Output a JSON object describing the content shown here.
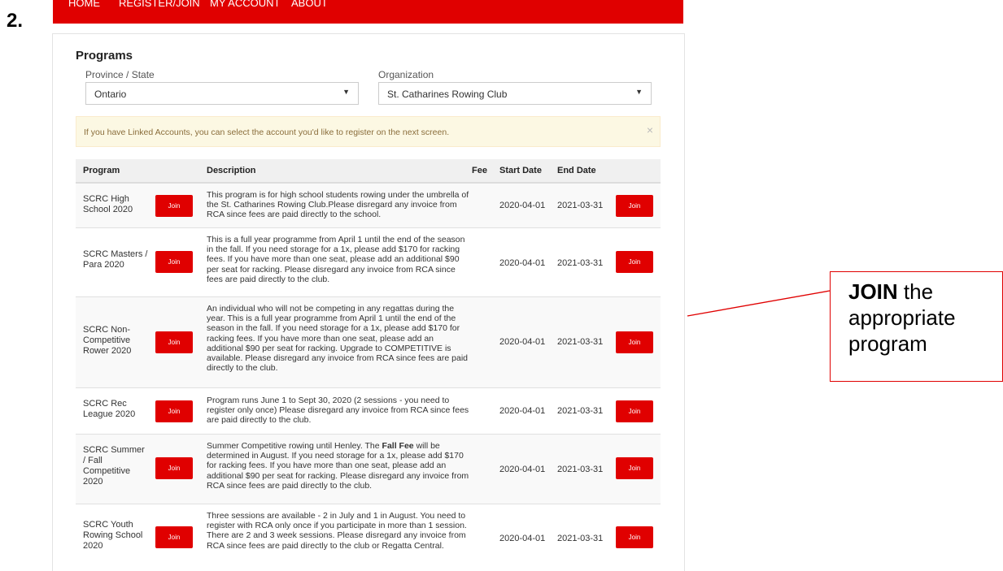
{
  "step_label": "2.",
  "nav": [
    "HOME",
    "REGISTER/JOIN",
    "MY ACCOUNT",
    "ABOUT"
  ],
  "programs": {
    "title": "Programs",
    "province_label": "Province / State",
    "province_value": "Ontario",
    "org_label": "Organization",
    "org_value": "St. Catharines Rowing Club"
  },
  "alert": {
    "message": "If you have Linked Accounts, you can select the account you'd like to register on the next screen.",
    "close": "×"
  },
  "table": {
    "headers": [
      "Program",
      "Description",
      "Fee",
      "Start Date",
      "End Date"
    ],
    "join_label": "Join",
    "rows": [
      {
        "program": "SCRC High School 2020",
        "description": "This program is for high school students rowing under the umbrella of the St. Catharines Rowing Club.Please disregard any invoice from RCA since fees are paid directly to the school.",
        "fee": "",
        "start": "2020-04-01",
        "end": "2021-03-31"
      },
      {
        "program": "SCRC Masters / Para 2020",
        "description": "This is a full year programme from April 1 until the end of the season in the fall. If you need storage for a 1x, please add $170 for racking fees. If you have more than one seat, please add an additional $90 per seat for racking. Please disregard any invoice from RCA since fees are paid directly to the club.",
        "fee": "",
        "start": "2020-04-01",
        "end": "2021-03-31"
      },
      {
        "program": "SCRC Non-Competitive Rower 2020",
        "description": "An individual who will not be competing in any regattas during the year. This is a full year programme from April 1 until the end of the season in the fall. If you need storage for a 1x, please add $170 for racking fees. If you have more than one seat, please add an additional $90 per seat for racking. Upgrade to COMPETITIVE is available. Please disregard any invoice from RCA since fees are paid directly to the club.",
        "fee": "",
        "start": "2020-04-01",
        "end": "2021-03-31"
      },
      {
        "program": "SCRC Rec League 2020",
        "description": "Program runs June 1 to Sept 30, 2020 (2 sessions - you need to register only once) Please disregard any invoice from RCA since fees are paid directly to the club.",
        "fee": "",
        "start": "2020-04-01",
        "end": "2021-03-31"
      },
      {
        "program": "SCRC Summer / Fall Competitive 2020",
        "description_pre": "Summer Competitive rowing until Henley. The ",
        "description_bold": "Fall Fee",
        "description_post": " will be determined in August. If you need storage for a 1x, please add $170 for racking fees. If you have more than one seat, please add an additional $90 per seat for racking. Please disregard any invoice from RCA since fees are paid directly to the club.",
        "fee": "",
        "start": "2020-04-01",
        "end": "2021-03-31"
      },
      {
        "program": "SCRC Youth Rowing School 2020",
        "description": "Three sessions are available - 2 in July and 1 in August. You need to register with RCA only once if you participate in more than 1 session. There are 2 and 3 week sessions. Please disregard any invoice from RCA since fees are paid directly to the club or Regatta Central.",
        "fee": "",
        "start": "2020-04-01",
        "end": "2021-03-31"
      }
    ]
  },
  "callout": {
    "bold": "JOIN",
    "line1_rest": " the",
    "line2": "appropriate",
    "line3": "program"
  },
  "colors": {
    "brand_red": "#e00000",
    "alert_bg": "#fcf8e3",
    "alert_text": "#8a6d3b"
  }
}
